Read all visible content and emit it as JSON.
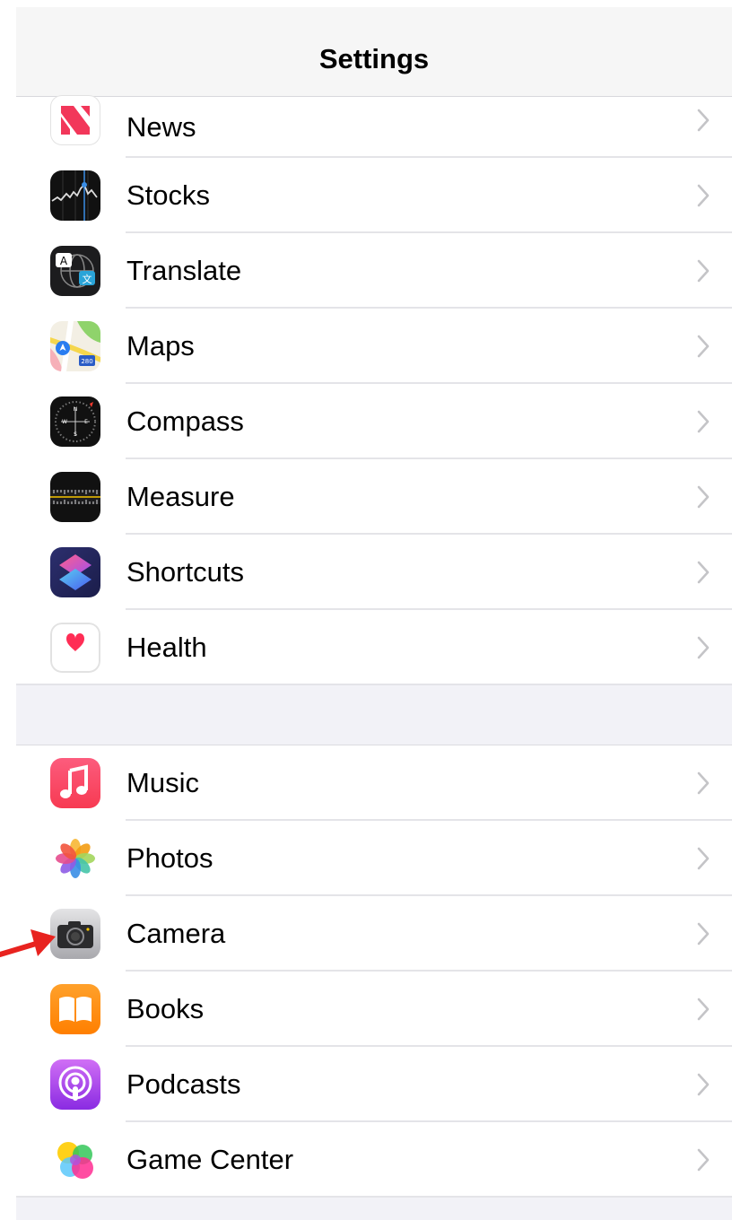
{
  "header": {
    "title": "Settings"
  },
  "group1": [
    {
      "label": "News",
      "icon": "news-icon"
    },
    {
      "label": "Stocks",
      "icon": "stocks-icon"
    },
    {
      "label": "Translate",
      "icon": "translate-icon"
    },
    {
      "label": "Maps",
      "icon": "maps-icon"
    },
    {
      "label": "Compass",
      "icon": "compass-icon"
    },
    {
      "label": "Measure",
      "icon": "measure-icon"
    },
    {
      "label": "Shortcuts",
      "icon": "shortcuts-icon"
    },
    {
      "label": "Health",
      "icon": "health-icon"
    }
  ],
  "group2": [
    {
      "label": "Music",
      "icon": "music-icon"
    },
    {
      "label": "Photos",
      "icon": "photos-icon"
    },
    {
      "label": "Camera",
      "icon": "camera-icon"
    },
    {
      "label": "Books",
      "icon": "books-icon"
    },
    {
      "label": "Podcasts",
      "icon": "podcasts-icon"
    },
    {
      "label": "Game Center",
      "icon": "game-center-icon"
    }
  ],
  "maps_icon_text": "280",
  "colors": {
    "background": "#f2f2f7",
    "separator": "#e4e4e8",
    "chevron": "#c4c4c7",
    "annotation_arrow": "#e8231f"
  }
}
